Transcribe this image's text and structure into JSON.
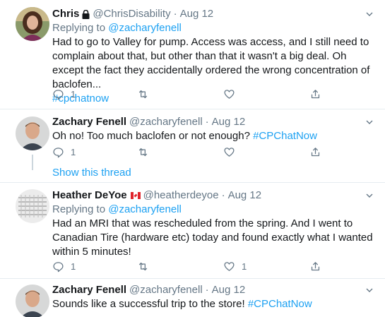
{
  "tweets": [
    {
      "name": "Chris",
      "handle": "@ChrisDisability",
      "date": "Aug 12",
      "replying_prefix": "Replying to ",
      "replying_to": "@zacharyfenell",
      "text_plain": "Had to go to Valley for pump. Access was access, and I still need to complain about that, but other than that it wasn't a big deal. Oh except the fact they accidentally ordered the wrong concentration of baclofen...",
      "hashtag": "#cpchatnow",
      "reply_count": "1",
      "retweet_count": "",
      "like_count": ""
    },
    {
      "name": "Zachary Fenell",
      "handle": "@zacharyfenell",
      "date": "Aug 12",
      "text_plain": "Oh no! Too much baclofen or not enough? ",
      "hashtag": "#CPChatNow",
      "reply_count": "1",
      "retweet_count": "",
      "like_count": ""
    },
    {
      "name": "Heather DeYoe",
      "handle": "@heatherdeyoe",
      "date": "Aug 12",
      "replying_prefix": "Replying to ",
      "replying_to": "@zacharyfenell",
      "text_plain": "Had an MRI that was rescheduled from the spring. And I went to Canadian Tire (hardware etc) today and found exactly what I wanted within 5 minutes!",
      "reply_count": "1",
      "retweet_count": "",
      "like_count": "1"
    },
    {
      "name": "Zachary Fenell",
      "handle": "@zacharyfenell",
      "date": "Aug 12",
      "text_plain": "Sounds like a successful trip to the store! ",
      "hashtag": "#CPChatNow"
    }
  ],
  "show_thread": "Show this thread",
  "separator": "·",
  "colors": {
    "link": "#1da1f2",
    "muted": "#657786",
    "divider": "#e6ecf0",
    "thread_line": "#ccd6dd"
  },
  "icons": [
    "lock-icon",
    "canada-flag-icon",
    "chevron-down-icon",
    "reply-icon",
    "retweet-icon",
    "like-icon",
    "share-icon"
  ]
}
